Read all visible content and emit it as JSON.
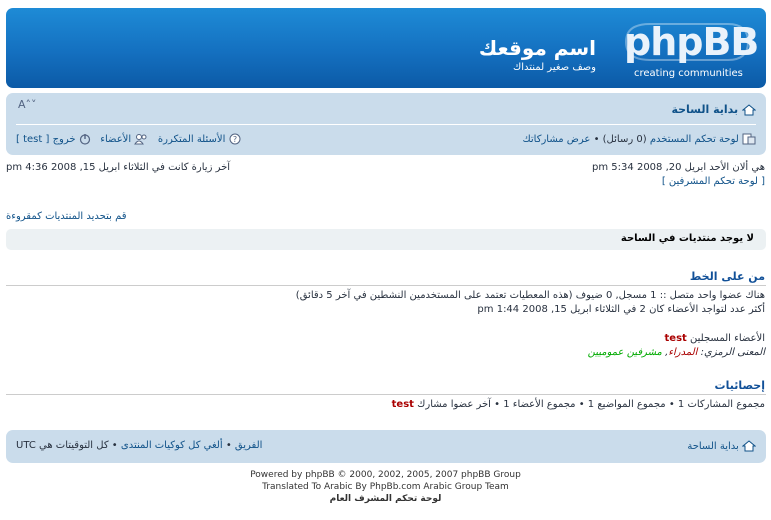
{
  "header": {
    "site_name": "اسم موقعك",
    "site_description": "وصف صغير لمنتداك",
    "logo_text": "phpBB",
    "logo_tagline": "creating communities"
  },
  "navbar": {
    "home_link": "بداية الساحة",
    "font_size_control": "A˄˅",
    "ucp_link": "لوحة تحكم المستخدم",
    "messages": "(0 رسائل)",
    "view_posts": "عرض مشاركاتك",
    "logout": "خروج [ test ]",
    "members": "الأعضاء",
    "faq": "الأسئلة المتكررة"
  },
  "info": {
    "current_time": "هي ألان الأحد ابريل 20, 2008 5:34 pm",
    "last_visit": "آخر زيارة كانت في الثلاثاء ابريل 15, 2008 4:36 pm",
    "mcp_link": "[ لوحة تحكم المشرفين ]",
    "mark_read": "قم بتحديد المنتديات كمقروءة",
    "no_forums": "لا يوجد منتديات في الساحة"
  },
  "online": {
    "title": "من على الخط",
    "line1": "هناك عضوا واحد متصل :: 1 مسجل, 0 ضيوف (هذه المعطيات تعتمد على المستخدمين النشطين في آخر 5 دقائق)",
    "line2": "أكثر عدد لتواجد الأعضاء كان 2 في الثلاثاء ابريل 15, 2008 1:44 pm",
    "registered_label": "الأعضاء المسجلين",
    "registered_user": "test",
    "legend_label": "المعنى الرمزي:",
    "legend_admins": "المدراء",
    "legend_mods": "مشرفين عموميين"
  },
  "stats": {
    "title": "إحصائيات",
    "line": "مجموع المشاركات 1 • مجموع المواضيع 1 • مجموع الأعضاء 1 • آخر عضوا مشارك",
    "newest_user": "test"
  },
  "footer": {
    "home_link": "بداية الساحة",
    "team": "الفريق",
    "delete_cookies": "ألغي كل كوكيات المنتدى",
    "timezone": "كل التوقيتات هي UTC",
    "powered": "Powered by phpBB © 2000, 2002, 2005, 2007 phpBB Group",
    "translated": "Translated To Arabic By PhpBb.com Arabic Group Team",
    "acp_link": "لوحة تحكم المشرف العام"
  },
  "colors": {
    "header_blue": "#1470c0",
    "navbar_bg": "#cadceb",
    "link": "#105289",
    "admin_red": "#aa0000",
    "mod_green": "#00aa00"
  }
}
